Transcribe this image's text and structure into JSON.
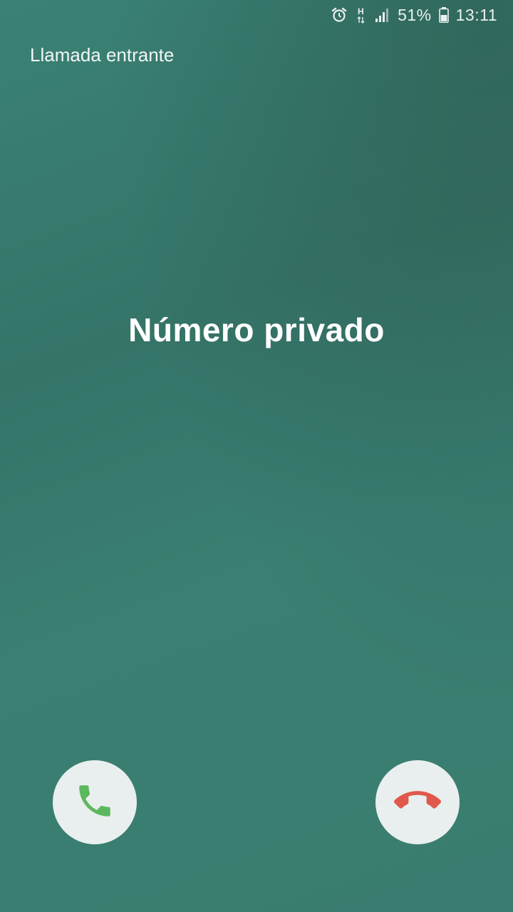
{
  "status_bar": {
    "icons": [
      "alarm-icon",
      "hspa-data-icon",
      "signal-icon",
      "battery-icon"
    ],
    "battery_percent": "51%",
    "time": "13:11"
  },
  "call": {
    "status_label": "Llamada entrante",
    "caller": "Número privado"
  },
  "actions": {
    "accept_icon": "phone-accept-icon",
    "decline_icon": "phone-decline-icon",
    "accept_color": "#5cb85c",
    "decline_color": "#e0574c"
  },
  "colors": {
    "background": "#3a7d70",
    "button_bg": "#e9efee"
  }
}
